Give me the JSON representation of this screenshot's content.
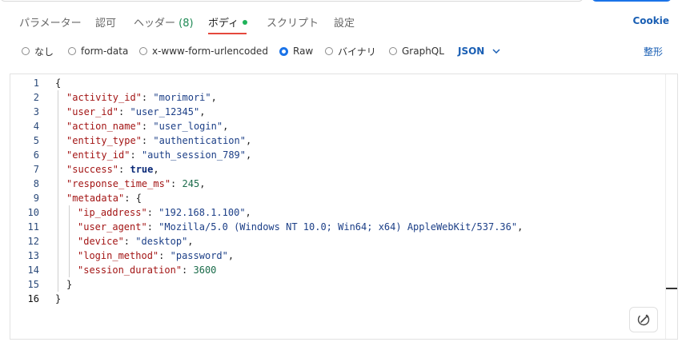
{
  "tabs": [
    {
      "label": "パラメーター"
    },
    {
      "label": "認可"
    },
    {
      "label": "ヘッダー",
      "count": "(8)"
    },
    {
      "label": "ボディ"
    },
    {
      "label": "スクリプト"
    },
    {
      "label": "設定"
    }
  ],
  "active_tab": "ボディ",
  "cookie_label": "Cookie",
  "body_types": [
    "なし",
    "form-data",
    "x-www-form-urlencoded",
    "Raw",
    "バイナリ",
    "GraphQL"
  ],
  "selected_body_type": "Raw",
  "format": {
    "selected": "JSON",
    "beautify_label": "整形"
  },
  "editor": {
    "lines": [
      {
        "n": "1"
      },
      {
        "n": "2"
      },
      {
        "n": "3"
      },
      {
        "n": "4"
      },
      {
        "n": "5"
      },
      {
        "n": "6"
      },
      {
        "n": "7"
      },
      {
        "n": "8"
      },
      {
        "n": "9"
      },
      {
        "n": "10"
      },
      {
        "n": "11"
      },
      {
        "n": "12"
      },
      {
        "n": "13"
      },
      {
        "n": "14"
      },
      {
        "n": "15"
      },
      {
        "n": "16"
      }
    ],
    "json": {
      "activity_id": "morimori",
      "user_id": "user_12345",
      "action_name": "user_login",
      "entity_type": "authentication",
      "entity_id": "auth_session_789",
      "success": "true",
      "response_time_ms": "245",
      "metadata": {
        "ip_address": "192.168.1.100",
        "user_agent": "Mozilla/5.0 (Windows NT 10.0; Win64; x64) AppleWebKit/537.36",
        "device": "desktop",
        "login_method": "password",
        "session_duration": "3600"
      }
    }
  },
  "icons": {
    "ai_button": "magic-wand-icon",
    "json_dropdown": "chevron-down-icon"
  },
  "colors": {
    "accent": "#1a73e8",
    "active_underline": "#e5483d",
    "status_dot": "#1fb35a"
  }
}
